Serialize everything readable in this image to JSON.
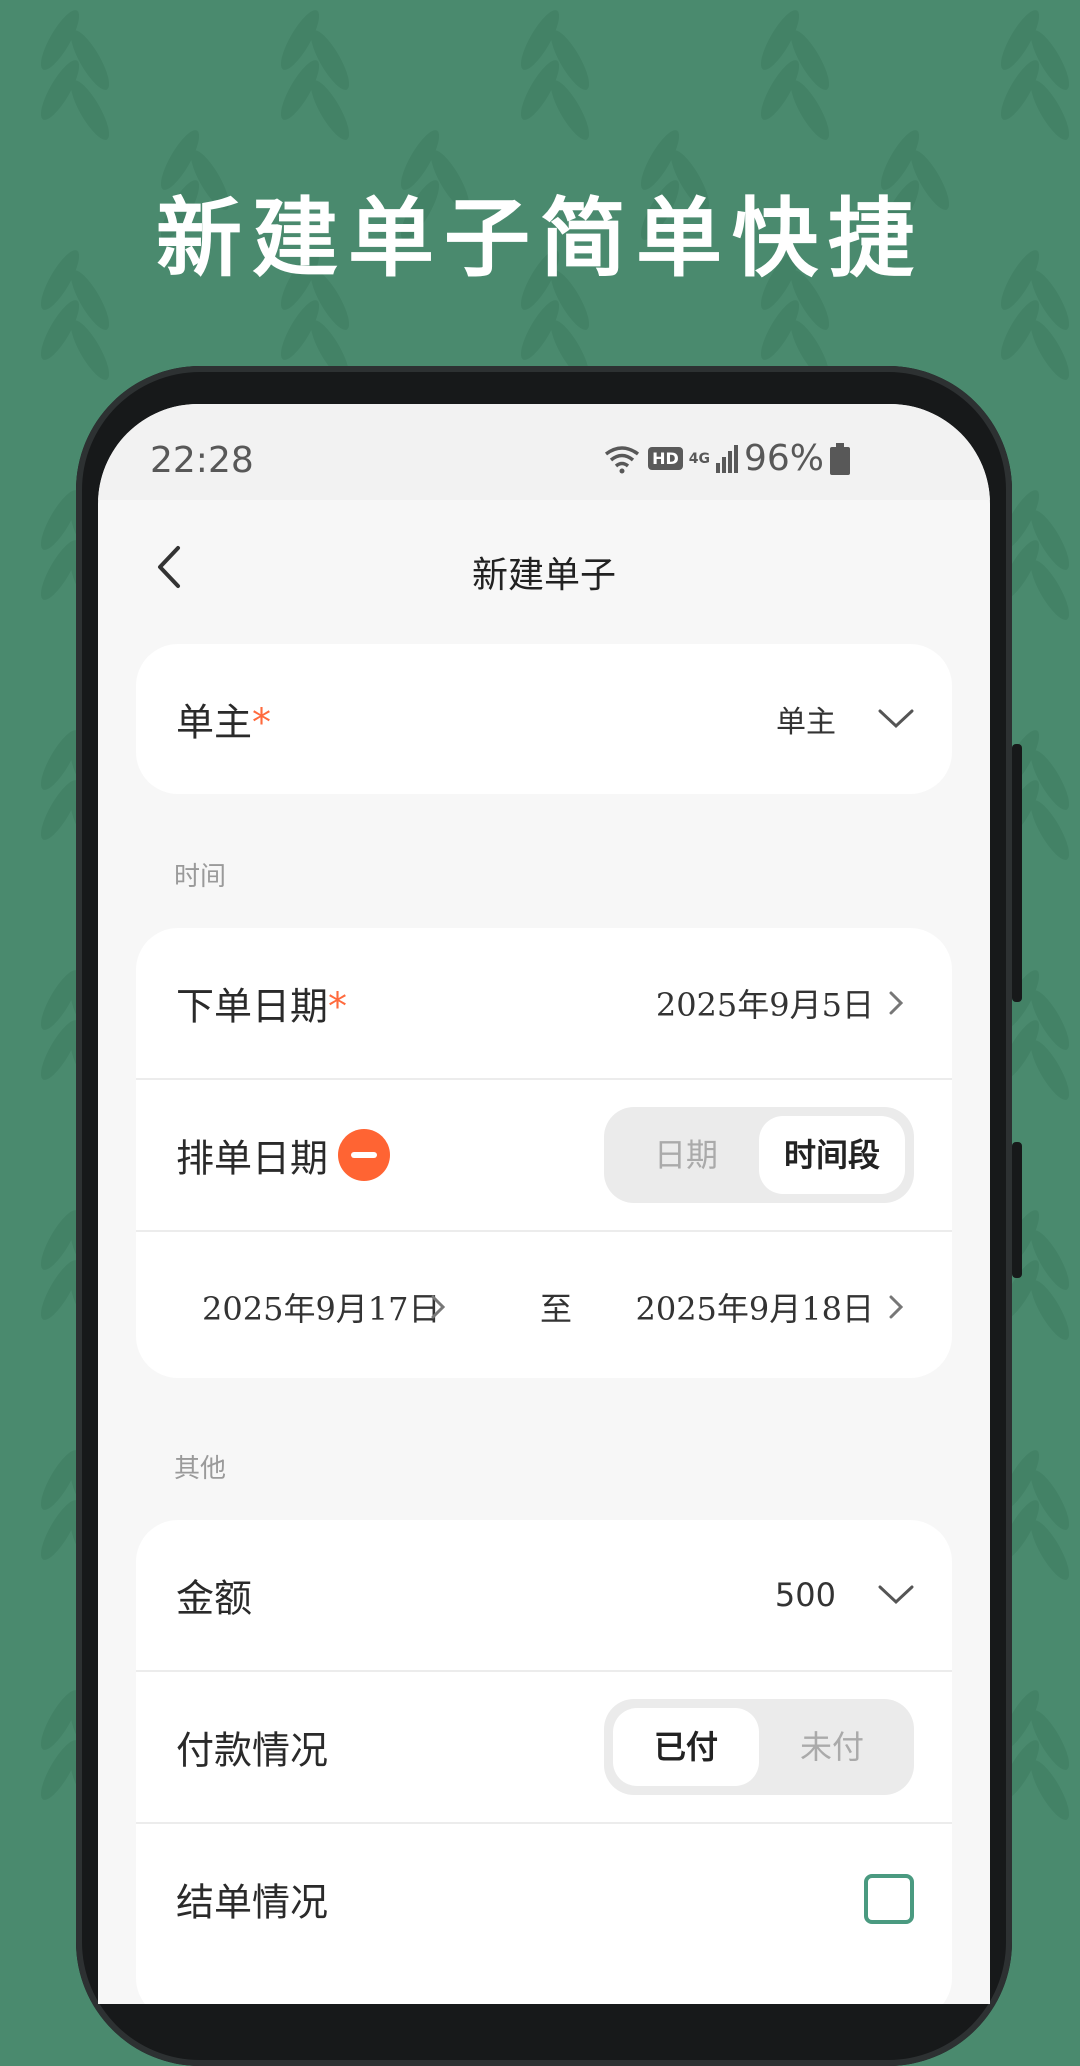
{
  "headline": "新建单子简单快捷",
  "status_bar": {
    "time": "22:28",
    "hd": "HD",
    "signal": "4G",
    "battery": "96%"
  },
  "nav": {
    "title": "新建单子"
  },
  "owner_row": {
    "label": "单主",
    "required_mark": "*",
    "value": "单主"
  },
  "section_time": "时间",
  "order_date": {
    "label": "下单日期",
    "required_mark": "*",
    "value": "2025年9月5日"
  },
  "schedule": {
    "label": "排单日期",
    "options": [
      "日期",
      "时间段"
    ],
    "selected": "时间段",
    "start": "2025年9月17日",
    "to_label": "至",
    "end": "2025年9月18日"
  },
  "section_other": "其他",
  "amount": {
    "label": "金额",
    "value": "500"
  },
  "payment": {
    "label": "付款情况",
    "options": [
      "已付",
      "未付"
    ],
    "selected": "已付"
  },
  "settlement": {
    "label": "结单情况",
    "checked": false
  },
  "colors": {
    "background": "#4a8a6e",
    "accent_required": "#ff6a3d",
    "minus_button": "#ff6433",
    "checkbox_border": "#4a9a80"
  }
}
